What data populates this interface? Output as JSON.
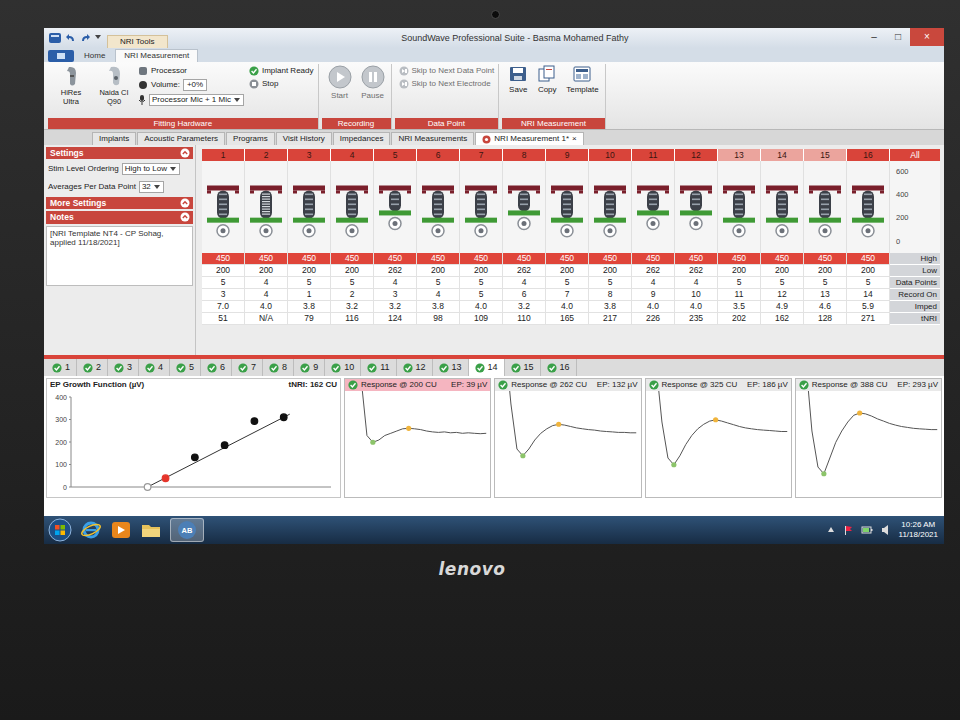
{
  "window": {
    "title": "SoundWave Professional Suite - Basma Mohamed Fathy",
    "context_tab": "NRI Tools",
    "controls": [
      "–",
      "□",
      "×"
    ]
  },
  "ribbon_tabs": [
    {
      "label": "Home",
      "selected": false
    },
    {
      "label": "NRI Measurement",
      "selected": true
    }
  ],
  "ribbon": {
    "hardware": {
      "devices": [
        "HiRes Ultra",
        "Naida CI Q90"
      ],
      "processor": "Processor",
      "volume_label": "Volume:",
      "volume_value": "+0%",
      "input": "Processor Mic + 1 Mic",
      "implant_ready": "Implant Ready",
      "stop": "Stop",
      "label": "Fitting Hardware"
    },
    "recording": {
      "buttons": [
        {
          "label": "Start",
          "disabled": true
        },
        {
          "label": "Pause",
          "disabled": true
        }
      ],
      "label": "Recording"
    },
    "data_point": {
      "buttons": [
        {
          "label": "Skip to Next Data Point",
          "disabled": true
        },
        {
          "label": "Skip to Next Electrode",
          "disabled": true
        }
      ],
      "label": "Data Point"
    },
    "nri": {
      "buttons": [
        {
          "label": "Save",
          "disabled": false
        },
        {
          "label": "Copy",
          "disabled": false
        },
        {
          "label": "Template",
          "disabled": false
        }
      ],
      "label": "NRI Measurement"
    }
  },
  "doc_tabs": [
    {
      "label": "Implants",
      "selected": false,
      "closable": false
    },
    {
      "label": "Acoustic Parameters",
      "selected": false,
      "closable": false
    },
    {
      "label": "Programs",
      "selected": false,
      "closable": false
    },
    {
      "label": "Visit History",
      "selected": false,
      "closable": false
    },
    {
      "label": "Impedances",
      "selected": false,
      "closable": false
    },
    {
      "label": "NRI Measurements",
      "selected": false,
      "closable": false
    },
    {
      "label": "NRI Measurement 1*",
      "selected": true,
      "closable": true
    }
  ],
  "doc_tab_close": "×",
  "settings": {
    "title": "Settings",
    "stim_label": "Stim Level Ordering",
    "stim_value": "High to Low",
    "avg_label": "Averages Per Data Point",
    "avg_value": "32",
    "more_title": "More Settings",
    "notes_title": "Notes",
    "notes": "[NRI Template NT4 - CP Sohag, applied 11/18/2021]"
  },
  "electrodes": {
    "header_all": "All",
    "axis_ticks": [
      "600",
      "400",
      "200",
      "0"
    ],
    "row_labels": [
      "High",
      "Low",
      "Data Points",
      "Record On",
      "Imped",
      "tNRI"
    ],
    "columns": [
      {
        "number": "1",
        "high": "450",
        "low": "200",
        "points": "5",
        "record": "3",
        "imped": "7.0",
        "tnri": "51",
        "dimmed": false,
        "disabled": false
      },
      {
        "number": "2",
        "high": "450",
        "low": "200",
        "points": "4",
        "record": "4",
        "imped": "4.0",
        "tnri": "N/A",
        "dimmed": false,
        "disabled": true
      },
      {
        "number": "3",
        "high": "450",
        "low": "200",
        "points": "5",
        "record": "1",
        "imped": "3.8",
        "tnri": "79",
        "dimmed": false,
        "disabled": false
      },
      {
        "number": "4",
        "high": "450",
        "low": "200",
        "points": "5",
        "record": "2",
        "imped": "3.2",
        "tnri": "116",
        "dimmed": false,
        "disabled": false
      },
      {
        "number": "5",
        "high": "450",
        "low": "262",
        "points": "4",
        "record": "3",
        "imped": "3.2",
        "tnri": "124",
        "dimmed": false,
        "disabled": false
      },
      {
        "number": "6",
        "high": "450",
        "low": "200",
        "points": "5",
        "record": "4",
        "imped": "3.8",
        "tnri": "98",
        "dimmed": false,
        "disabled": false
      },
      {
        "number": "7",
        "high": "450",
        "low": "200",
        "points": "5",
        "record": "5",
        "imped": "4.0",
        "tnri": "109",
        "dimmed": false,
        "disabled": false
      },
      {
        "number": "8",
        "high": "450",
        "low": "262",
        "points": "4",
        "record": "6",
        "imped": "3.2",
        "tnri": "110",
        "dimmed": false,
        "disabled": false
      },
      {
        "number": "9",
        "high": "450",
        "low": "200",
        "points": "5",
        "record": "7",
        "imped": "4.0",
        "tnri": "165",
        "dimmed": false,
        "disabled": false
      },
      {
        "number": "10",
        "high": "450",
        "low": "200",
        "points": "5",
        "record": "8",
        "imped": "3.8",
        "tnri": "217",
        "dimmed": false,
        "disabled": false
      },
      {
        "number": "11",
        "high": "450",
        "low": "262",
        "points": "4",
        "record": "9",
        "imped": "4.0",
        "tnri": "226",
        "dimmed": false,
        "disabled": false
      },
      {
        "number": "12",
        "high": "450",
        "low": "262",
        "points": "4",
        "record": "10",
        "imped": "4.0",
        "tnri": "235",
        "dimmed": false,
        "disabled": false
      },
      {
        "number": "13",
        "high": "450",
        "low": "200",
        "points": "5",
        "record": "11",
        "imped": "3.5",
        "tnri": "202",
        "dimmed": true,
        "disabled": false
      },
      {
        "number": "14",
        "high": "450",
        "low": "200",
        "points": "5",
        "record": "12",
        "imped": "4.9",
        "tnri": "162",
        "dimmed": true,
        "disabled": false
      },
      {
        "number": "15",
        "high": "450",
        "low": "200",
        "points": "5",
        "record": "13",
        "imped": "4.6",
        "tnri": "128",
        "dimmed": true,
        "disabled": false
      },
      {
        "number": "16",
        "high": "450",
        "low": "200",
        "points": "5",
        "record": "14",
        "imped": "5.9",
        "tnri": "271",
        "dimmed": false,
        "disabled": false
      }
    ]
  },
  "electrode_tabs": [
    {
      "label": "1",
      "checked": true,
      "selected": false
    },
    {
      "label": "2",
      "checked": true,
      "selected": false
    },
    {
      "label": "3",
      "checked": true,
      "selected": false
    },
    {
      "label": "4",
      "checked": true,
      "selected": false
    },
    {
      "label": "5",
      "checked": true,
      "selected": false
    },
    {
      "label": "6",
      "checked": true,
      "selected": false
    },
    {
      "label": "7",
      "checked": true,
      "selected": false
    },
    {
      "label": "8",
      "checked": true,
      "selected": false
    },
    {
      "label": "9",
      "checked": true,
      "selected": false
    },
    {
      "label": "10",
      "checked": true,
      "selected": false
    },
    {
      "label": "11",
      "checked": true,
      "selected": false
    },
    {
      "label": "12",
      "checked": true,
      "selected": false
    },
    {
      "label": "13",
      "checked": true,
      "selected": false
    },
    {
      "label": "14",
      "checked": true,
      "selected": true
    },
    {
      "label": "15",
      "checked": true,
      "selected": false
    },
    {
      "label": "16",
      "checked": true,
      "selected": false
    }
  ],
  "growth": {
    "title": "EP Growth Function (µV)",
    "tnri": "tNRI: 162 CU",
    "y_ticks": [
      "400",
      "300",
      "200",
      "100",
      "0"
    ],
    "points": [
      {
        "cu": 162,
        "uv": 0,
        "kind": "threshold"
      },
      {
        "cu": 200,
        "uv": 39,
        "kind": "selected"
      },
      {
        "cu": 262,
        "uv": 132,
        "kind": "point"
      },
      {
        "cu": 325,
        "uv": 186,
        "kind": "point"
      },
      {
        "cu": 388,
        "uv": 293,
        "kind": "point"
      },
      {
        "cu": 450,
        "uv": 310,
        "kind": "point"
      }
    ]
  },
  "responses": [
    {
      "title": "Response @ 200 CU",
      "ep": "EP: 39 µV",
      "selected": true,
      "checked": true,
      "n1": 4,
      "p2": 10,
      "samples": [
        300,
        250,
        120,
        -10,
        -25,
        -20,
        -10,
        -5,
        0,
        5,
        6,
        5,
        3,
        0,
        -2,
        -3,
        -2,
        -4,
        -3,
        -5,
        -4,
        -5,
        -6,
        -5
      ]
    },
    {
      "title": "Response @ 262 CU",
      "ep": "EP: 132 µV",
      "selected": false,
      "checked": true,
      "n1": 4,
      "p2": 10,
      "samples": [
        300,
        200,
        60,
        -40,
        -55,
        -40,
        -20,
        -5,
        5,
        12,
        15,
        13,
        10,
        7,
        5,
        3,
        2,
        0,
        -1,
        -2,
        -3,
        -3,
        -4,
        -4
      ]
    },
    {
      "title": "Response @ 325 CU",
      "ep": "EP: 186 µV",
      "selected": false,
      "checked": true,
      "n1": 4,
      "p2": 11,
      "samples": [
        300,
        150,
        20,
        -60,
        -75,
        -55,
        -30,
        -10,
        5,
        15,
        22,
        25,
        22,
        18,
        14,
        10,
        7,
        5,
        3,
        2,
        1,
        0,
        -1,
        -1
      ]
    },
    {
      "title": "Response @ 388 CU",
      "ep": "EP: 293 µV",
      "selected": false,
      "checked": true,
      "n1": 4,
      "p2": 10,
      "samples": [
        300,
        150,
        0,
        -80,
        -95,
        -60,
        -25,
        0,
        20,
        35,
        40,
        38,
        33,
        27,
        22,
        17,
        13,
        10,
        8,
        6,
        5,
        4,
        3,
        3
      ]
    }
  ],
  "taskbar": {
    "apps": [
      {
        "label": "AB",
        "selected": true
      }
    ],
    "time": "10:26 AM",
    "date": "11/18/2021"
  },
  "bezel": {
    "brand": "lenovo"
  }
}
